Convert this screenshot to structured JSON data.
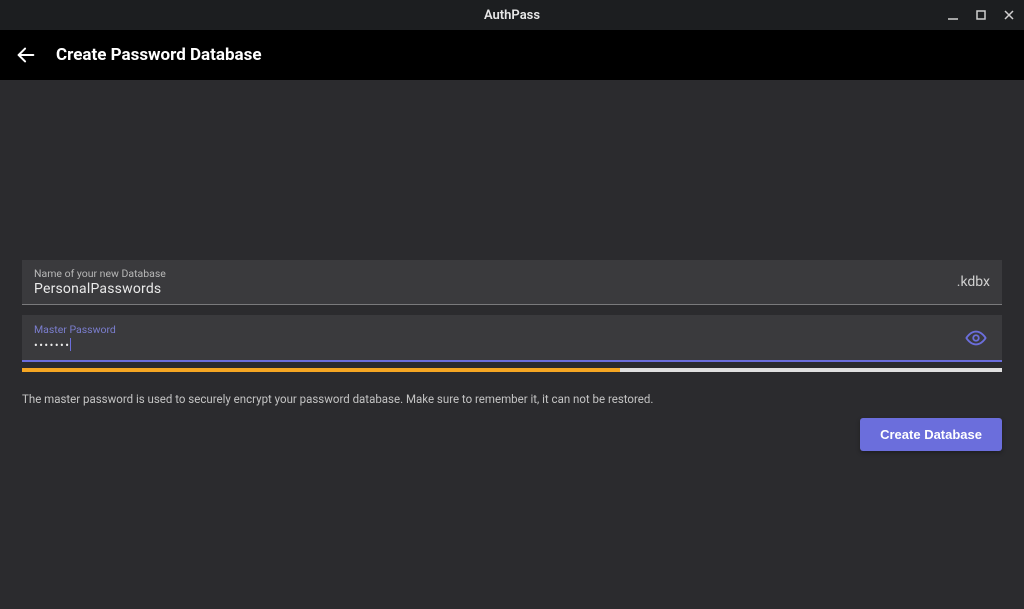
{
  "window": {
    "title": "AuthPass"
  },
  "appbar": {
    "title": "Create Password Database"
  },
  "fields": {
    "name": {
      "label": "Name of your new Database",
      "value": "PersonalPasswords",
      "suffix": ".kdbx"
    },
    "password": {
      "label": "Master Password",
      "value_masked": "•••••••",
      "strength_percent": 61
    }
  },
  "helper_text": "The master password is used to securely encrypt your password database. Make sure to remember it, it can not be restored.",
  "actions": {
    "create_label": "Create Database"
  },
  "colors": {
    "accent": "#6b6edc",
    "strength": "#f5a623",
    "bg": "#2b2b2e",
    "field_bg": "#3a3a3d",
    "titlebar_bg": "#1c1e20",
    "appbar_bg": "#000000"
  }
}
